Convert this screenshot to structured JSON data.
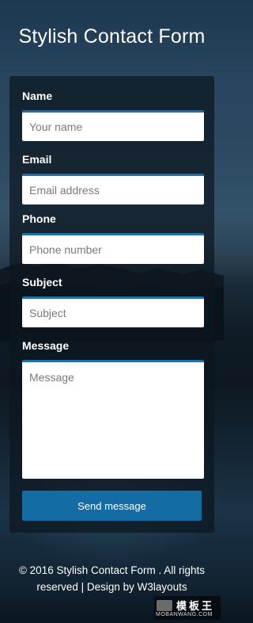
{
  "page": {
    "title": "Stylish Contact Form"
  },
  "form": {
    "name": {
      "label": "Name",
      "placeholder": "Your name"
    },
    "email": {
      "label": "Email",
      "placeholder": "Email address"
    },
    "phone": {
      "label": "Phone",
      "placeholder": "Phone number"
    },
    "subject": {
      "label": "Subject",
      "placeholder": "Subject"
    },
    "message": {
      "label": "Message",
      "placeholder": "Message"
    },
    "submit_label": "Send message"
  },
  "footer": {
    "line1": "© 2016 Stylish Contact Form . All rights",
    "line2": "reserved | Design by W3layouts"
  },
  "watermark": {
    "title": "模板王",
    "url": "MOBANWANG.COM"
  },
  "colors": {
    "accent": "#1f6fa6",
    "button": "#136ca3",
    "panel": "#0c161e"
  },
  "icons": {
    "watermark_logo": "mobanwang-logo-icon"
  }
}
